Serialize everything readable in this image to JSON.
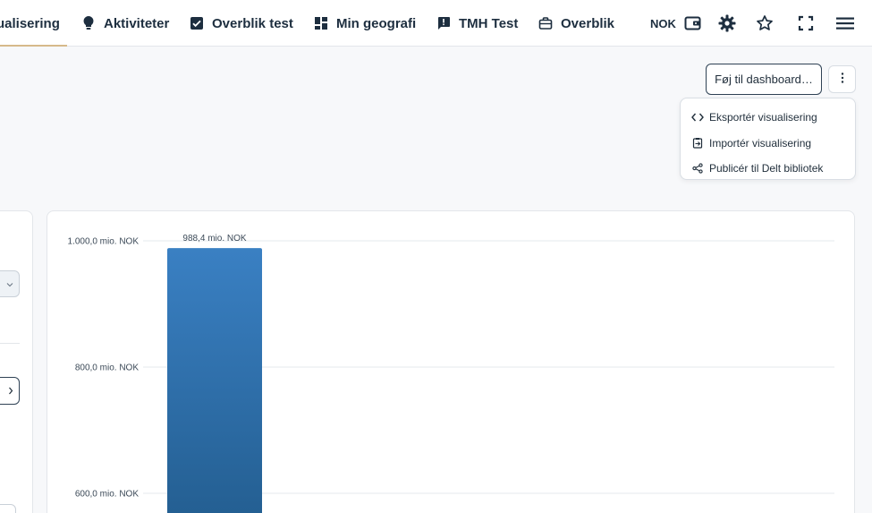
{
  "nav": {
    "tabs": [
      {
        "label": "ualisering",
        "icon": "chart-icon",
        "active": true
      },
      {
        "label": "Aktiviteter",
        "icon": "lightbulb-icon",
        "active": false
      },
      {
        "label": "Overblik test",
        "icon": "checkbox-icon",
        "active": false
      },
      {
        "label": "Min geografi",
        "icon": "dashboard-icon",
        "active": false
      },
      {
        "label": "TMH Test",
        "icon": "feedback-icon",
        "active": false
      },
      {
        "label": "Overblik",
        "icon": "briefcase-icon",
        "active": false
      }
    ],
    "currency": "NOK",
    "icons": [
      "wallet-icon",
      "gear-icon",
      "star-icon",
      "fullscreen-icon",
      "hamburger-icon"
    ]
  },
  "toolbar": {
    "add_to_dashboard": "Føj til dashboard…"
  },
  "menu": {
    "items": [
      {
        "label": "Eksportér visualisering",
        "icon": "code-icon"
      },
      {
        "label": "Importér visualisering",
        "icon": "import-icon"
      },
      {
        "label": "Publicér til Delt bibliotek",
        "icon": "share-icon"
      }
    ]
  },
  "colors": {
    "accent_underline": "#d6b98a",
    "bar_top": "#3a80c3",
    "bar_bottom": "#245f92",
    "nav_text": "#1d2e3f"
  },
  "chart_data": {
    "type": "bar",
    "categories": [
      ""
    ],
    "values": [
      988.4
    ],
    "data_labels": [
      "988,4 mio. NOK"
    ],
    "y_ticks": [
      {
        "value": 1000,
        "label": "1.000,0 mio. NOK"
      },
      {
        "value": 800,
        "label": "800,0 mio. NOK"
      },
      {
        "value": 600,
        "label": "600,0 mio. NOK"
      }
    ],
    "grid": true
  }
}
